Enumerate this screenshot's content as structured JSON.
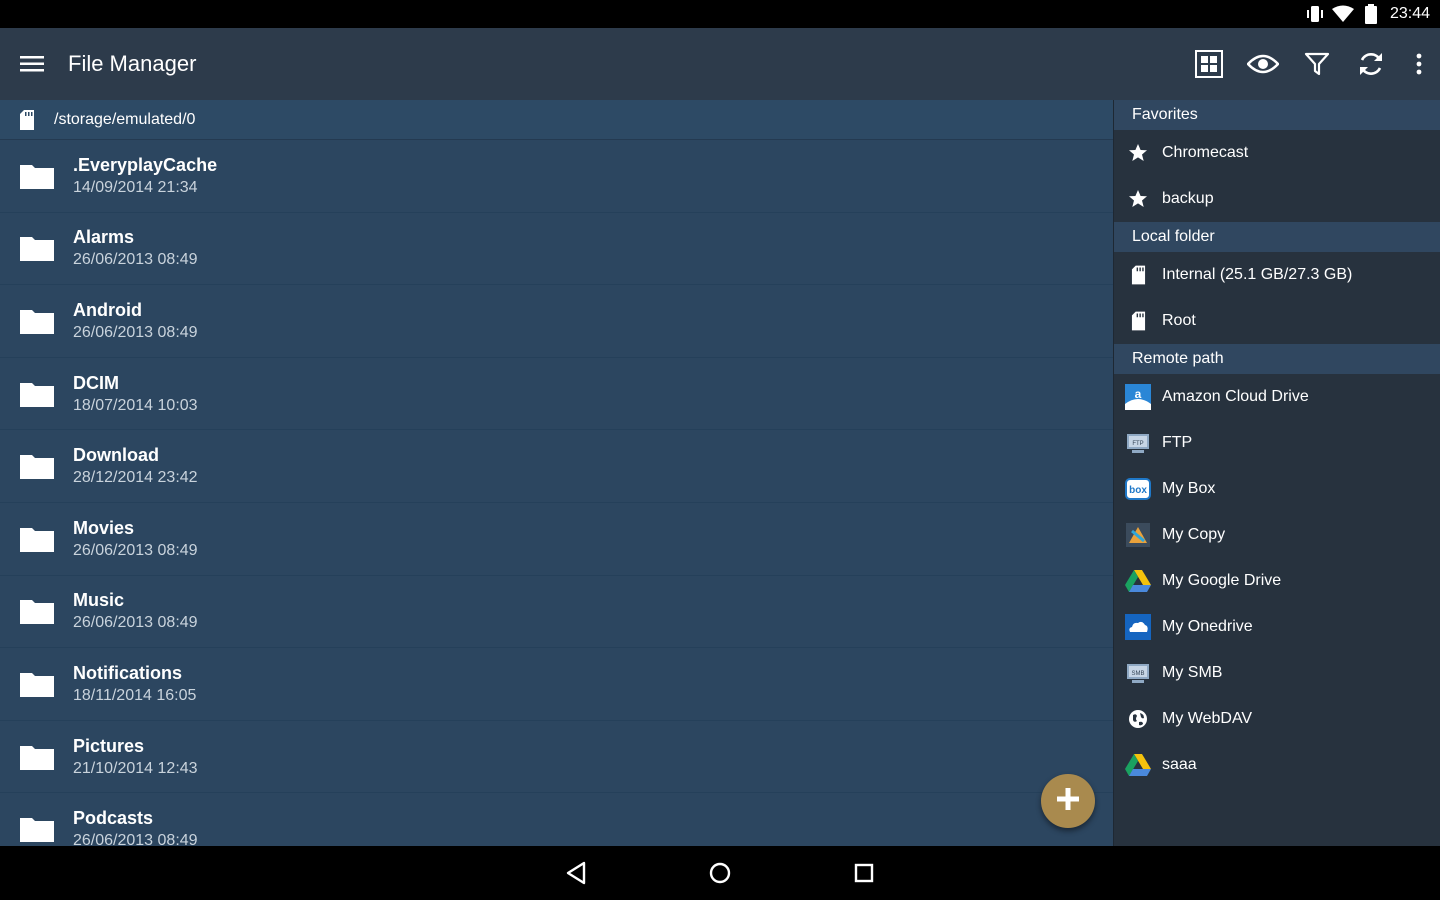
{
  "status_bar": {
    "time": "23:44",
    "icons": [
      "vibrate-icon",
      "wifi-icon",
      "battery-icon"
    ]
  },
  "toolbar": {
    "title": "File Manager",
    "actions": [
      "grid-view-icon",
      "eye-icon",
      "filter-icon",
      "refresh-icon",
      "overflow-menu-icon"
    ]
  },
  "path_bar": {
    "path": "/storage/emulated/0"
  },
  "files": [
    {
      "name": ".EveryplayCache",
      "date": "14/09/2014 21:34"
    },
    {
      "name": "Alarms",
      "date": "26/06/2013 08:49"
    },
    {
      "name": "Android",
      "date": "26/06/2013 08:49"
    },
    {
      "name": "DCIM",
      "date": "18/07/2014 10:03"
    },
    {
      "name": "Download",
      "date": "28/12/2014 23:42"
    },
    {
      "name": "Movies",
      "date": "26/06/2013 08:49"
    },
    {
      "name": "Music",
      "date": "26/06/2013 08:49"
    },
    {
      "name": "Notifications",
      "date": "18/11/2014 16:05"
    },
    {
      "name": "Pictures",
      "date": "21/10/2014 12:43"
    },
    {
      "name": "Podcasts",
      "date": "26/06/2013 08:49"
    }
  ],
  "drawer": {
    "favorites": {
      "header": "Favorites",
      "items": [
        "Chromecast",
        "backup"
      ]
    },
    "local": {
      "header": "Local folder",
      "items": [
        "Internal (25.1 GB/27.3 GB)",
        "Root"
      ]
    },
    "remote": {
      "header": "Remote path",
      "items": [
        {
          "label": "Amazon Cloud Drive",
          "icon": "amazon-cloud-drive-icon"
        },
        {
          "label": "FTP",
          "icon": "ftp-icon"
        },
        {
          "label": "My Box",
          "icon": "box-icon"
        },
        {
          "label": "My Copy",
          "icon": "copy-icon"
        },
        {
          "label": "My Google Drive",
          "icon": "google-drive-icon"
        },
        {
          "label": "My Onedrive",
          "icon": "onedrive-icon"
        },
        {
          "label": "My SMB",
          "icon": "smb-icon"
        },
        {
          "label": "My WebDAV",
          "icon": "webdav-globe-icon"
        },
        {
          "label": "saaa",
          "icon": "google-drive-icon"
        }
      ]
    }
  },
  "colors": {
    "toolbar": "#2d3b4b",
    "list_bg": "#2c4660",
    "drawer_bg": "#27323e",
    "section_header": "#304760",
    "fab": "#a98a4e"
  }
}
